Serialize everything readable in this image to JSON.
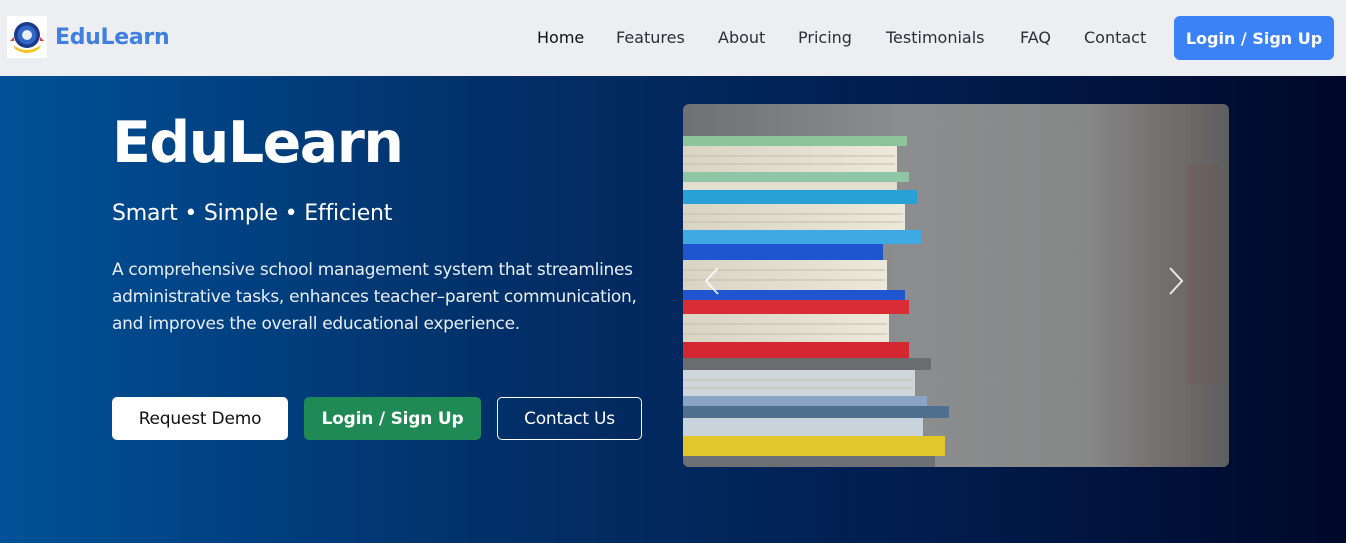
{
  "header": {
    "brand_name": "EduLearn",
    "nav": [
      {
        "label": "Home",
        "active": true
      },
      {
        "label": "Features"
      },
      {
        "label": "About"
      },
      {
        "label": "Pricing"
      },
      {
        "label": "Testimonials"
      },
      {
        "label": "FAQ"
      },
      {
        "label": "Contact"
      }
    ],
    "cta_label": "Login / Sign Up"
  },
  "hero": {
    "title": "EduLearn",
    "tagline": "Smart • Simple • Efficient",
    "description": "A comprehensive school management system that streamlines administrative tasks, enhances teacher–parent communication, and improves the overall educational experience.",
    "buttons": {
      "demo": "Request Demo",
      "login": "Login / Sign Up",
      "contact": "Contact Us"
    }
  },
  "carousel": {
    "prev_icon": "chevron-left-icon",
    "next_icon": "chevron-right-icon"
  },
  "colors": {
    "brand": "#3f7fe0",
    "cta": "#3b82f6",
    "login_green": "#1f8a55",
    "hero_dark": "#00082a"
  }
}
